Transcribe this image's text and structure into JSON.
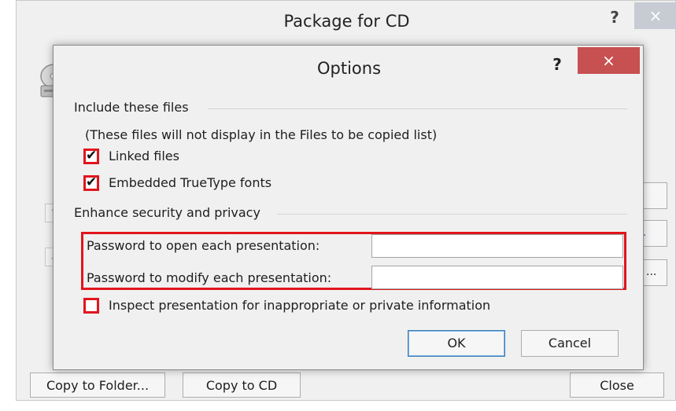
{
  "back_dialog": {
    "title": "Package for CD",
    "help_glyph": "?",
    "close_glyph": "×",
    "icon": "cd-drive-icon",
    "up_arrow": "↑",
    "down_arrow": "↓",
    "side_button_2": ".",
    "side_button_3": "...",
    "buttons": {
      "copy_to_folder": "Copy to Folder...",
      "copy_to_cd": "Copy to CD",
      "close": "Close"
    }
  },
  "options_dialog": {
    "title": "Options",
    "help_glyph": "?",
    "close_glyph": "×",
    "include_section": {
      "title": "Include these files",
      "note": "(These files will not display in the Files to be copied list)",
      "linked_files": {
        "label": "Linked files",
        "checked": true,
        "tick": "✔"
      },
      "embedded_fonts": {
        "label": "Embedded TrueType fonts",
        "checked": true,
        "tick": "✔"
      }
    },
    "security_section": {
      "title": "Enhance security and privacy",
      "password_open_label": "Password to open each presentation:",
      "password_open_value": "",
      "password_modify_label": "Password to modify each presentation:",
      "password_modify_value": "",
      "inspect": {
        "label": "Inspect presentation for inappropriate or private information",
        "checked": false
      }
    },
    "buttons": {
      "ok": "OK",
      "cancel": "Cancel"
    }
  },
  "colors": {
    "highlight_red": "#e0161c",
    "close_red": "#c75050",
    "dialog_bg": "#f0f0f0"
  }
}
